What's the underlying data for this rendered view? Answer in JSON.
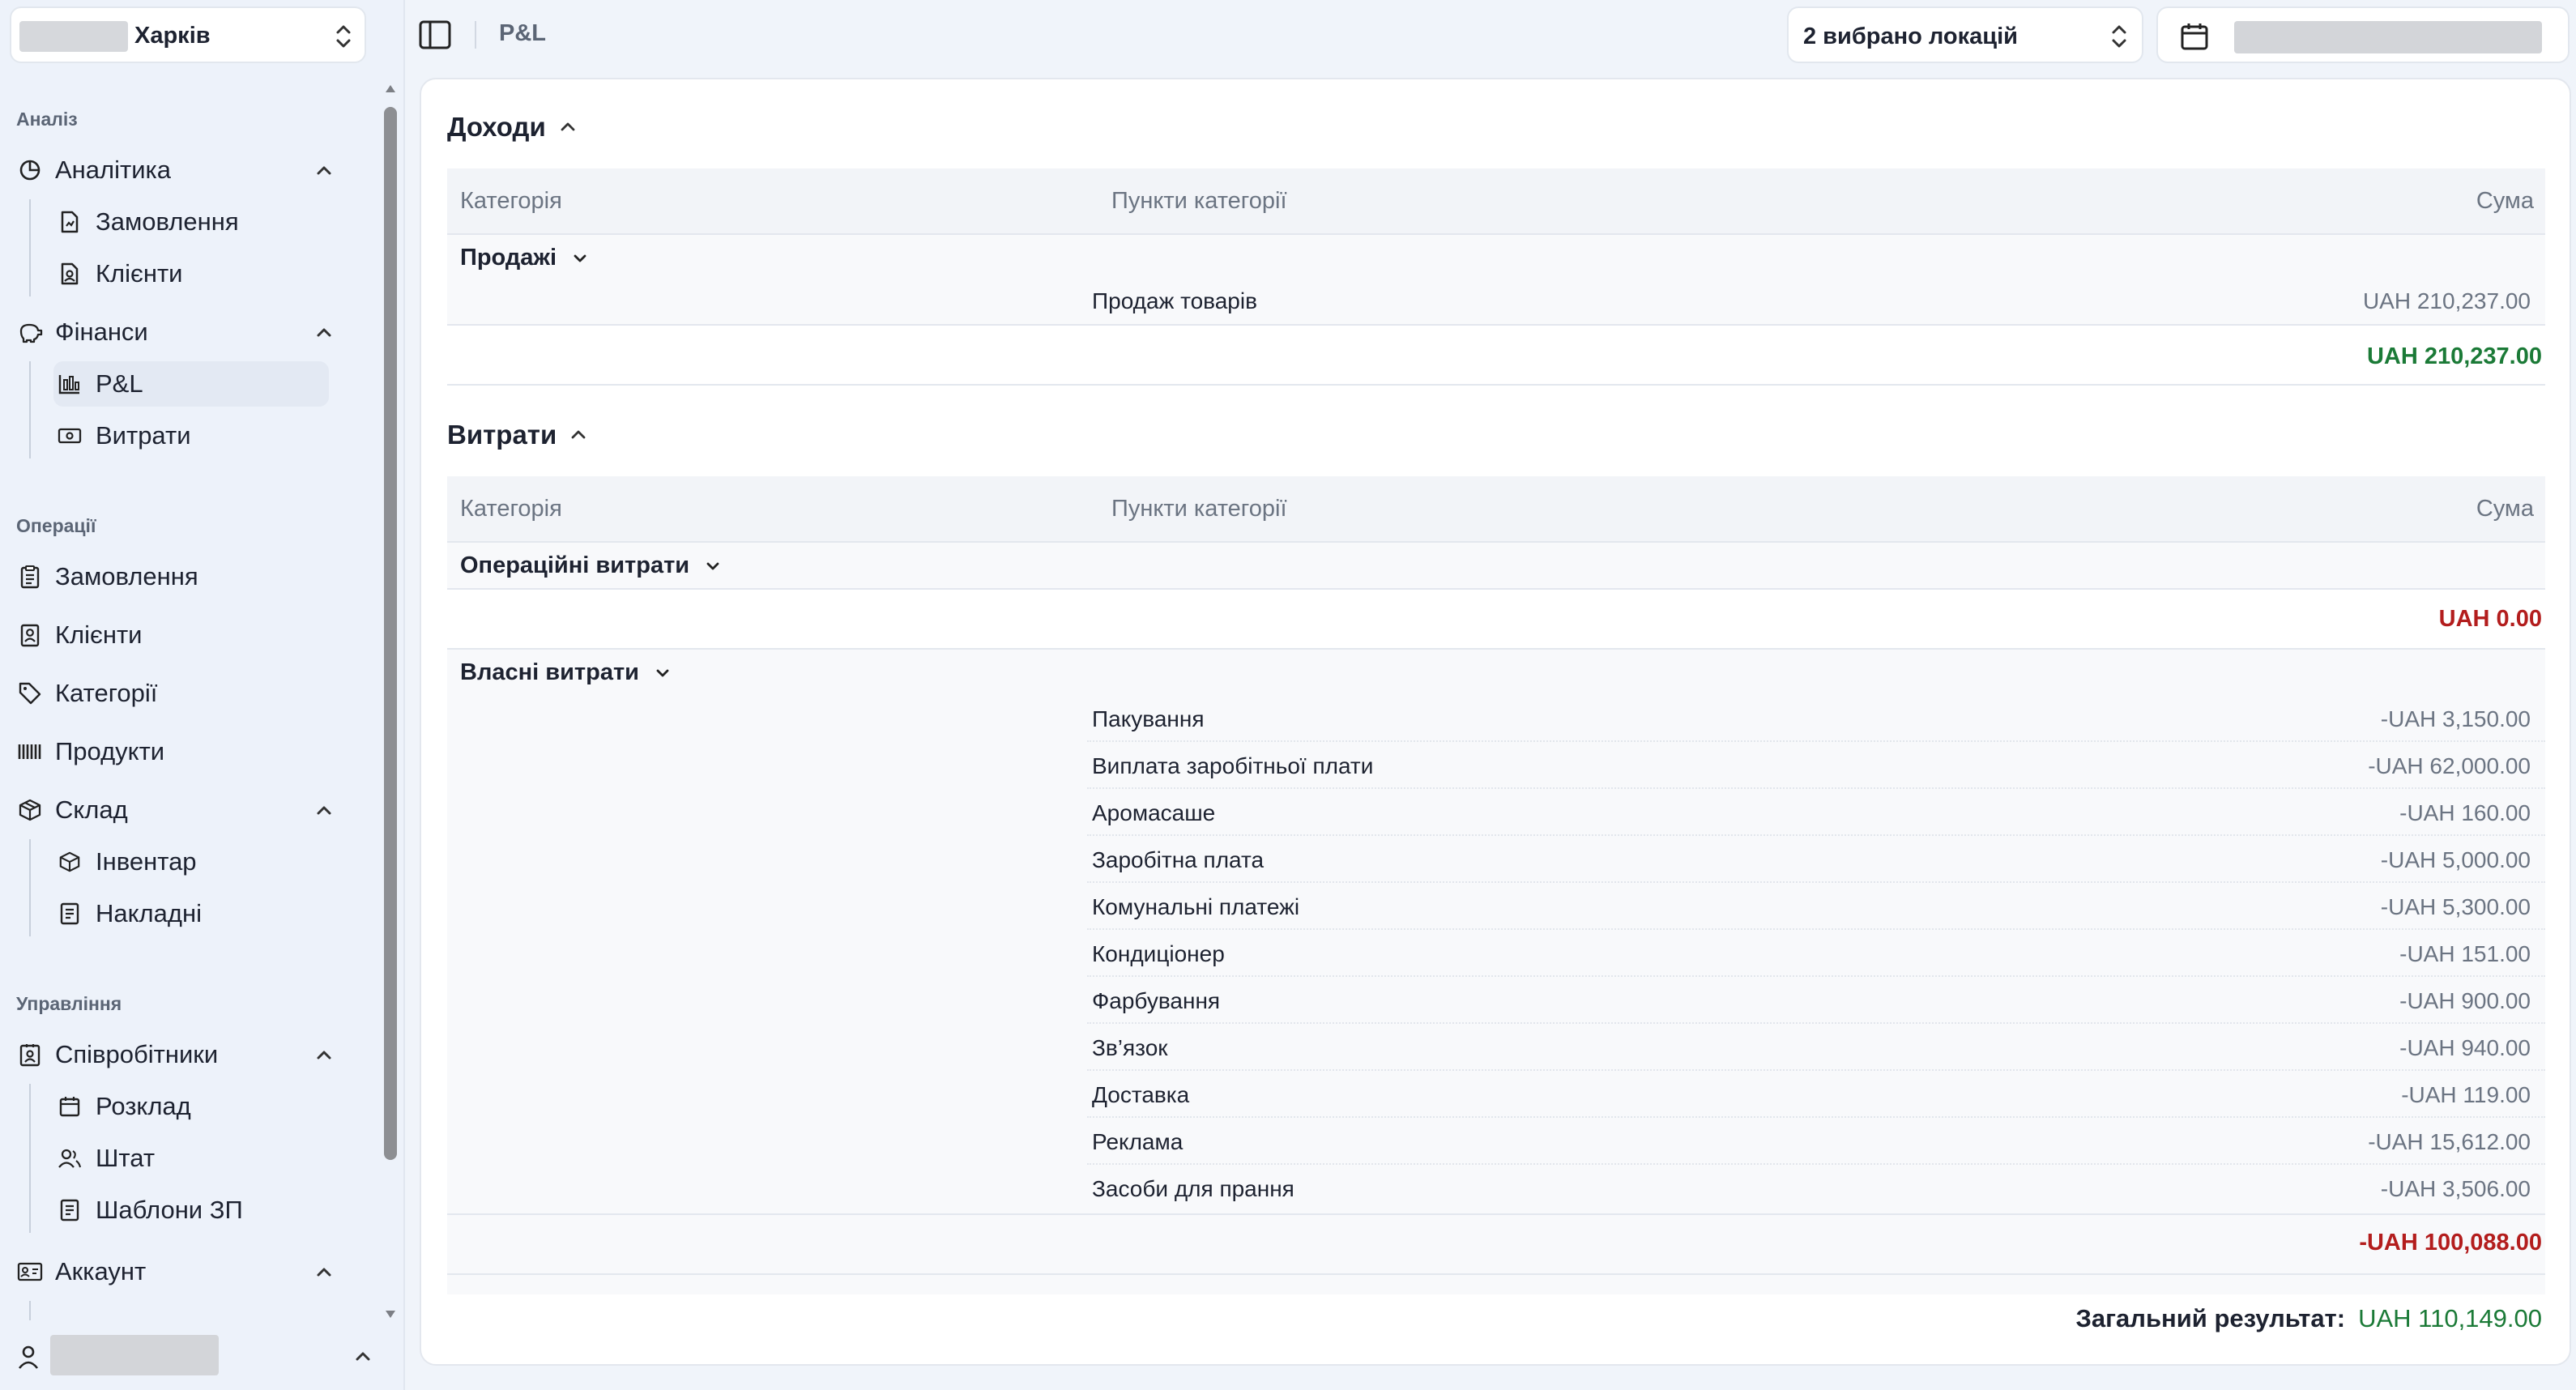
{
  "sidebar": {
    "location": "Харків",
    "sections": {
      "analysis": "Аналіз",
      "operations": "Операції",
      "management": "Управління"
    },
    "items": {
      "analytics": "Аналітика",
      "analytics_orders": "Замовлення",
      "analytics_clients": "Клієнти",
      "finance": "Фінанси",
      "finance_pl": "P&L",
      "finance_expenses": "Витрати",
      "orders": "Замовлення",
      "clients": "Клієнти",
      "categories": "Категорії",
      "products": "Продукти",
      "warehouse": "Склад",
      "inventory": "Інвентар",
      "invoices": "Накладні",
      "employees": "Співробітники",
      "schedule": "Розклад",
      "staff": "Штат",
      "salary_templates": "Шаблони ЗП",
      "account": "Аккаунт"
    }
  },
  "topbar": {
    "breadcrumb": "P&L",
    "locations_selected": "2 вибрано локацій"
  },
  "income": {
    "title": "Доходи",
    "headers": {
      "category": "Категорія",
      "items": "Пункти категорії",
      "sum": "Сума"
    },
    "categories": [
      {
        "name": "Продажі",
        "items": [
          {
            "name": "Продаж товарів",
            "value": "UAH 210,237.00"
          }
        ]
      }
    ],
    "total": "UAH 210,237.00"
  },
  "expenses": {
    "title": "Витрати",
    "headers": {
      "category": "Категорія",
      "items": "Пункти категорії",
      "sum": "Сума"
    },
    "operational": {
      "name": "Операційні витрати",
      "total": "UAH 0.00"
    },
    "own": {
      "name": "Власні витрати",
      "items": [
        {
          "name": "Пакування",
          "value": "-UAH 3,150.00"
        },
        {
          "name": "Виплата заробітньої плати",
          "value": "-UAH 62,000.00"
        },
        {
          "name": "Аромасаше",
          "value": "-UAH 160.00"
        },
        {
          "name": "Заробітна плата",
          "value": "-UAH 5,000.00"
        },
        {
          "name": "Комунальні платежі",
          "value": "-UAH 5,300.00"
        },
        {
          "name": "Кондиціонер",
          "value": "-UAH 151.00"
        },
        {
          "name": "Фарбування",
          "value": "-UAH 900.00"
        },
        {
          "name": "Зв’язок",
          "value": "-UAH 940.00"
        },
        {
          "name": "Доставка",
          "value": "-UAH 119.00"
        },
        {
          "name": "Реклама",
          "value": "-UAH 15,612.00"
        },
        {
          "name": "Засоби для прання",
          "value": "-UAH 3,506.00"
        }
      ],
      "total": "-UAH 100,088.00"
    }
  },
  "result": {
    "label": "Загальний результат:",
    "value": "UAH 110,149.00"
  },
  "colors": {
    "positive": "#1b7a37",
    "negative": "#b31d1d",
    "sidebar_bg": "#edf2fa"
  }
}
